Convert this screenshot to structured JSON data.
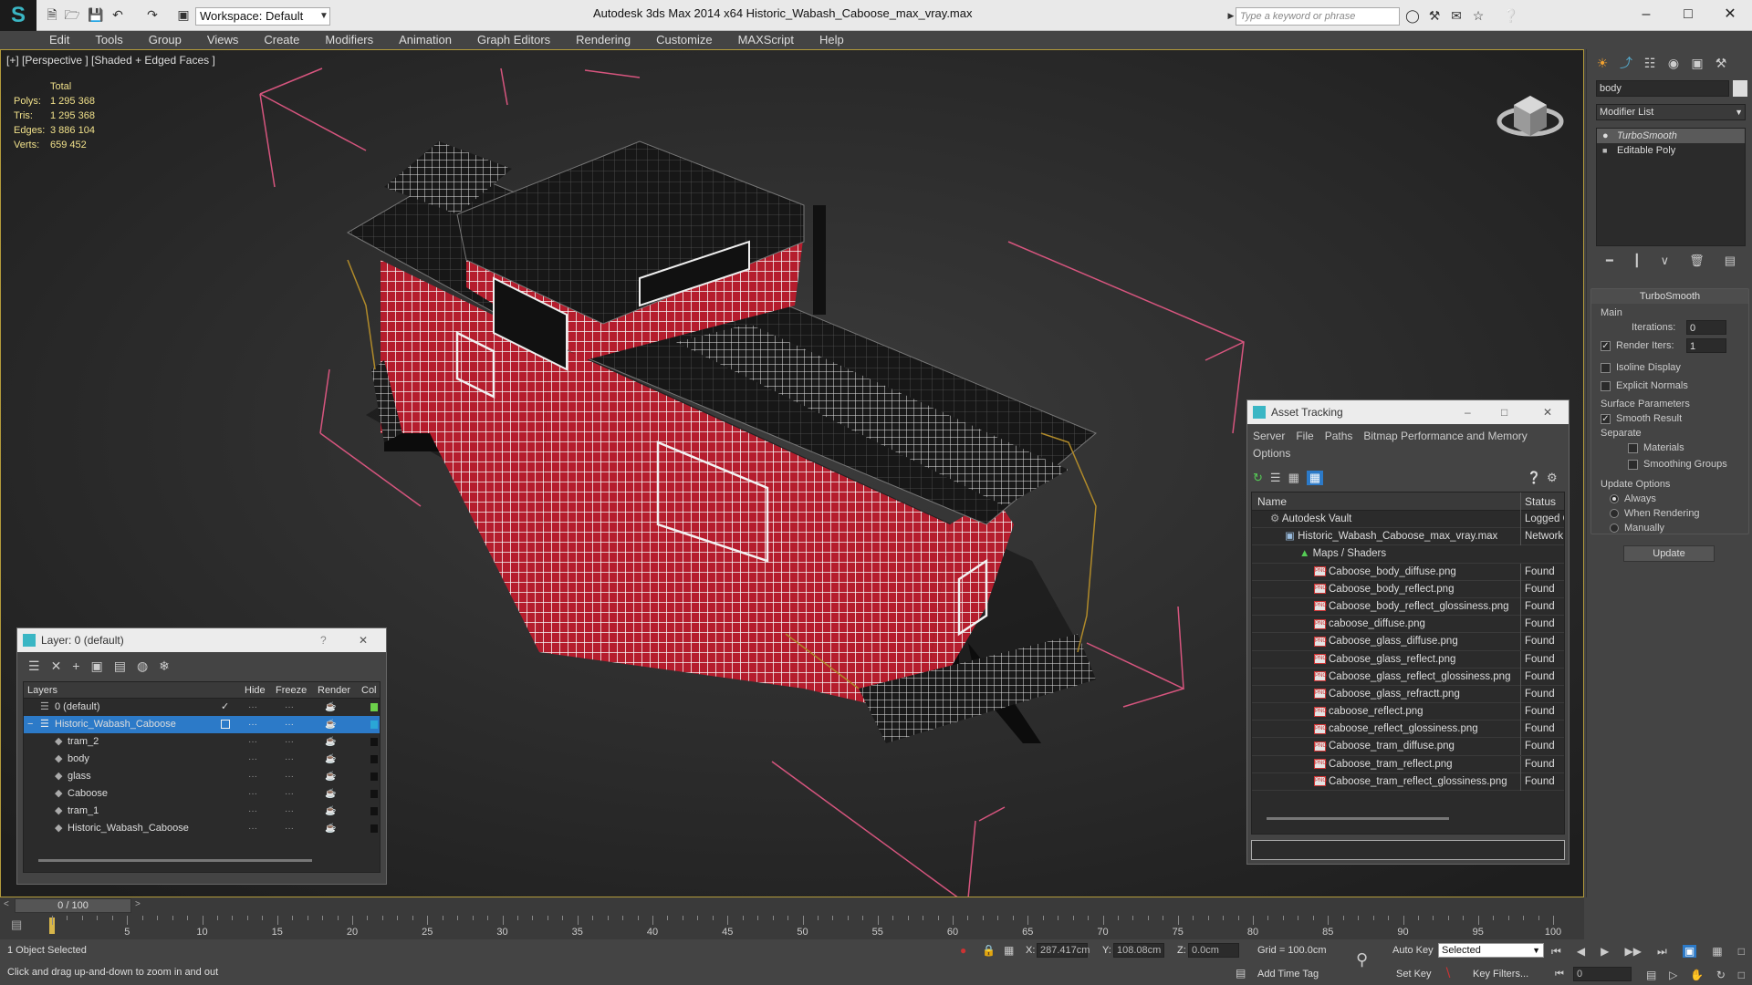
{
  "titlebar": {
    "workspace": "Workspace: Default",
    "app_title": "Autodesk 3ds Max  2014 x64      Historic_Wabash_Caboose_max_vray.max",
    "search_placeholder": "Type a keyword or phrase",
    "minimize": "–",
    "maximize": "□",
    "close": "✕"
  },
  "menubar": [
    "Edit",
    "Tools",
    "Group",
    "Views",
    "Create",
    "Modifiers",
    "Animation",
    "Graph Editors",
    "Rendering",
    "Customize",
    "MAXScript",
    "Help"
  ],
  "viewport": {
    "label": "[+] [Perspective ] [Shaded + Edged Faces ]",
    "stats_header": "Total",
    "stats": [
      {
        "key": "Polys:",
        "value": "1 295 368"
      },
      {
        "key": "Tris:",
        "value": "1 295 368"
      },
      {
        "key": "Edges:",
        "value": "3 886 104"
      },
      {
        "key": "Verts:",
        "value": "659 452"
      }
    ],
    "frame_color": "#b39b3b",
    "bbox_color": "#d6557e",
    "wire_color": "#c11d2e"
  },
  "command_panel": {
    "object_name": "body",
    "modifier_list": "Modifier List",
    "stack": [
      "TurboSmooth",
      "Editable Poly"
    ],
    "rollout_title": "TurboSmooth",
    "main_label": "Main",
    "iterations_label": "Iterations:",
    "iterations_value": "0",
    "render_iters_label": "Render Iters:",
    "render_iters_value": "1",
    "isoline_label": "Isoline Display",
    "explicit_normals_label": "Explicit Normals",
    "surface_params_label": "Surface Parameters",
    "smooth_result_label": "Smooth Result",
    "separate_label": "Separate",
    "materials_label": "Materials",
    "smoothing_groups_label": "Smoothing Groups",
    "update_options_label": "Update Options",
    "always_label": "Always",
    "when_rendering_label": "When Rendering",
    "manually_label": "Manually",
    "update_button": "Update"
  },
  "layer_dialog": {
    "title": "Layer: 0 (default)",
    "help": "?",
    "close": "✕",
    "columns": [
      "Layers",
      "Hide",
      "Freeze",
      "Render",
      "Col"
    ],
    "rows": [
      {
        "name": "0 (default)",
        "color": "#6cd04a"
      },
      {
        "name": "Historic_Wabash_Caboose",
        "color": "#2aa6d6"
      },
      {
        "name": "tram_2",
        "color": "#111111"
      },
      {
        "name": "body",
        "color": "#111111"
      },
      {
        "name": "glass",
        "color": "#111111"
      },
      {
        "name": "Caboose",
        "color": "#111111"
      },
      {
        "name": "tram_1",
        "color": "#111111"
      },
      {
        "name": "Historic_Wabash_Caboose",
        "color": "#111111"
      }
    ]
  },
  "asset_dialog": {
    "title": "Asset Tracking",
    "menu": [
      "Server",
      "File",
      "Paths",
      "Bitmap Performance and Memory",
      "Options"
    ],
    "columns": [
      "Name",
      "Status"
    ],
    "rows": [
      {
        "name": "Autodesk Vault",
        "status": "Logged Out",
        "kind": "vault"
      },
      {
        "name": "Historic_Wabash_Caboose_max_vray.max",
        "status": "Network",
        "kind": "file"
      },
      {
        "name": "Maps / Shaders",
        "status": "",
        "kind": "folder"
      },
      {
        "name": "Caboose_body_diffuse.png",
        "status": "Found",
        "kind": "png"
      },
      {
        "name": "Caboose_body_reflect.png",
        "status": "Found",
        "kind": "png"
      },
      {
        "name": "Caboose_body_reflect_glossiness.png",
        "status": "Found",
        "kind": "png"
      },
      {
        "name": "caboose_diffuse.png",
        "status": "Found",
        "kind": "png"
      },
      {
        "name": "Caboose_glass_diffuse.png",
        "status": "Found",
        "kind": "png"
      },
      {
        "name": "Caboose_glass_reflect.png",
        "status": "Found",
        "kind": "png"
      },
      {
        "name": "Caboose_glass_reflect_glossiness.png",
        "status": "Found",
        "kind": "png"
      },
      {
        "name": "Caboose_glass_refractt.png",
        "status": "Found",
        "kind": "png"
      },
      {
        "name": "caboose_reflect.png",
        "status": "Found",
        "kind": "png"
      },
      {
        "name": "caboose_reflect_glossiness.png",
        "status": "Found",
        "kind": "png"
      },
      {
        "name": "Caboose_tram_diffuse.png",
        "status": "Found",
        "kind": "png"
      },
      {
        "name": "Caboose_tram_reflect.png",
        "status": "Found",
        "kind": "png"
      },
      {
        "name": "Caboose_tram_reflect_glossiness.png",
        "status": "Found",
        "kind": "png"
      }
    ]
  },
  "timeline": {
    "frame": "0 / 100",
    "ticks": [
      "0",
      "5",
      "10",
      "15",
      "20",
      "25",
      "30",
      "35",
      "40",
      "45",
      "50",
      "55",
      "60",
      "65",
      "70",
      "75",
      "80",
      "85",
      "90",
      "95",
      "100"
    ]
  },
  "statusbar": {
    "selected": "1 Object Selected",
    "prompt": "Click and drag up-and-down to zoom in and out",
    "x_label": "X:",
    "x_value": "287.417cm",
    "y_label": "Y:",
    "y_value": "108.08cm",
    "z_label": "Z:",
    "z_value": "0.0cm",
    "grid": "Grid = 100.0cm",
    "add_time_tag": "Add Time Tag",
    "auto_key": "Auto Key",
    "selected_dropdown": "Selected",
    "set_key": "Set Key",
    "key_filters": "Key Filters...",
    "frame_field": "0"
  }
}
